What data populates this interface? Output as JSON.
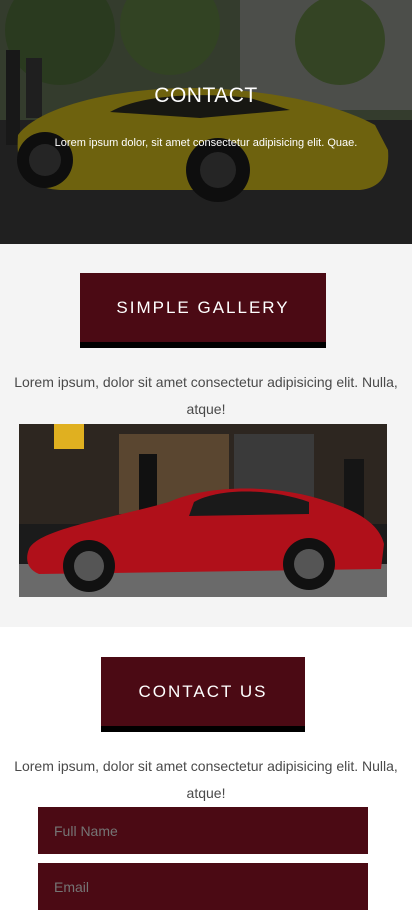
{
  "hero": {
    "title": "CONTACT",
    "subtitle": "Lorem ipsum dolor, sit amet consectetur adipisicing elit. Quae."
  },
  "gallery": {
    "heading": "SIMPLE GALLERY",
    "text": "Lorem ipsum, dolor sit amet consectetur adipisicing elit. Nulla, atque!"
  },
  "contact": {
    "heading": "CONTACT US",
    "text": "Lorem ipsum, dolor sit amet consectetur adipisicing elit. Nulla, atque!",
    "fields": [
      {
        "placeholder": "Full Name",
        "value": ""
      },
      {
        "placeholder": "Email",
        "value": ""
      }
    ]
  },
  "colors": {
    "accent": "#4b0a14",
    "hero_overlay": "#000000",
    "section_bg": "#f4f4f4"
  }
}
